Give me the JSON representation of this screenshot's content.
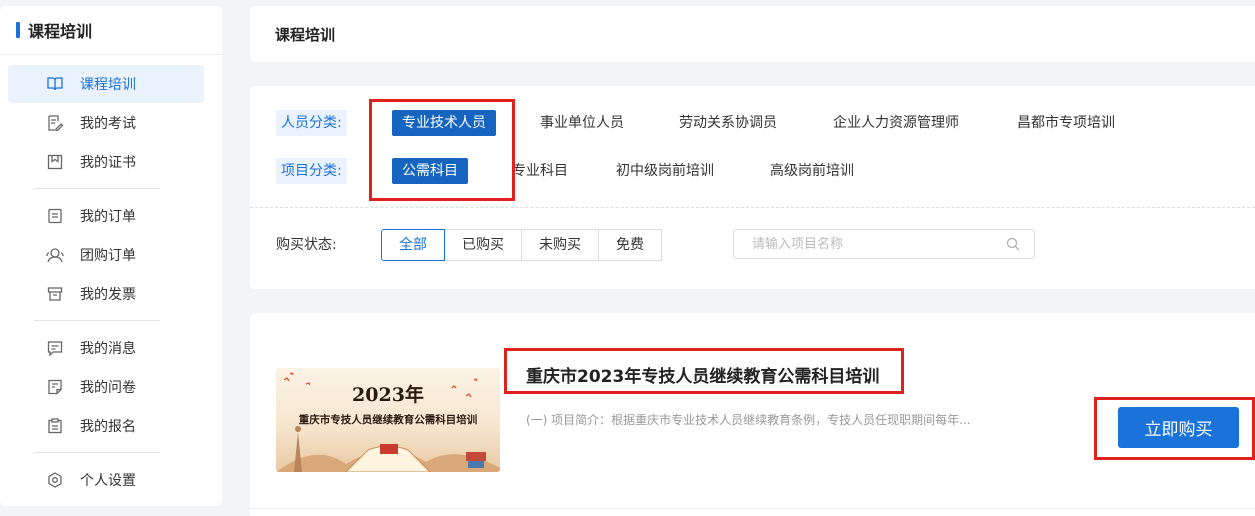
{
  "sidebar": {
    "title": "课程培训",
    "items": [
      {
        "label": "课程培训",
        "icon": "book-icon"
      },
      {
        "label": "我的考试",
        "icon": "exam-icon"
      },
      {
        "label": "我的证书",
        "icon": "certificate-icon"
      },
      {
        "label": "我的订单",
        "icon": "order-icon"
      },
      {
        "label": "团购订单",
        "icon": "group-icon"
      },
      {
        "label": "我的发票",
        "icon": "invoice-icon"
      },
      {
        "label": "我的消息",
        "icon": "message-icon"
      },
      {
        "label": "我的问卷",
        "icon": "survey-icon"
      },
      {
        "label": "我的报名",
        "icon": "clipboard-icon"
      },
      {
        "label": "个人设置",
        "icon": "settings-icon"
      }
    ]
  },
  "header": {
    "title": "课程培训"
  },
  "filters": {
    "personnel_label": "人员分类:",
    "personnel_options": [
      "专业技术人员",
      "事业单位人员",
      "劳动关系协调员",
      "企业人力资源管理师",
      "昌都市专项培训"
    ],
    "project_label": "项目分类:",
    "project_options": [
      "公需科目",
      "专业科目",
      "初中级岗前培训",
      "高级岗前培训"
    ],
    "status_label": "购买状态:",
    "status_options": [
      "全部",
      "已购买",
      "未购买",
      "免费"
    ],
    "search_placeholder": "请输入项目名称"
  },
  "course": {
    "thumb_year": "2023年",
    "thumb_title": "重庆市专技人员继续教育公需科目培训",
    "title": "重庆市2023年专技人员继续教育公需科目培训",
    "description": "(一) 项目简介：根据重庆市专业技术人员继续教育条例，专技人员任现职期间每年...",
    "buy_label": "立即购买"
  },
  "colors": {
    "accent": "#1a73d9",
    "selected": "#1565c0",
    "highlight": "#e0211e"
  }
}
